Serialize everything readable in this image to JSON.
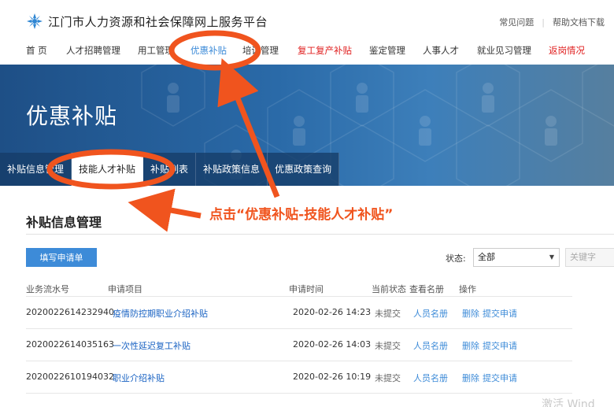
{
  "header": {
    "site_title": "江门市人力资源和社会保障网上服务平台",
    "links": [
      "常见问题",
      "帮助文档下载"
    ]
  },
  "nav": {
    "items": [
      {
        "label": "首 页"
      },
      {
        "label": "人才招聘管理"
      },
      {
        "label": "用工管理"
      },
      {
        "label": "优惠补贴"
      },
      {
        "label": "培训管理"
      },
      {
        "label": "复工复产补贴"
      },
      {
        "label": "鉴定管理"
      },
      {
        "label": "人事人才"
      },
      {
        "label": "就业见习管理"
      },
      {
        "label": "返岗情况"
      }
    ]
  },
  "banner": {
    "title": "优惠补贴"
  },
  "tabs": [
    "补贴信息管理",
    "技能人才补贴",
    "补贴列表",
    "补贴政策信息",
    "优惠政策查询"
  ],
  "main": {
    "section_title": "补贴信息管理",
    "apply_button": "填写申请单",
    "status_label": "状态:",
    "status_value": "全部",
    "keyword_placeholder": "关键字"
  },
  "table": {
    "headers": [
      "业务流水号",
      "申请项目",
      "申请时间",
      "当前状态",
      "查看名册",
      "操作"
    ],
    "rows": [
      {
        "id": "2020022614232940",
        "item": "疫情防控期职业介绍补贴",
        "time": "2020-02-26 14:23",
        "status": "未提交",
        "roster": "人员名册",
        "delete": "删除",
        "submit": "提交申请"
      },
      {
        "id": "2020022614035163",
        "item": "一次性延迟复工补贴",
        "time": "2020-02-26 14:03",
        "status": "未提交",
        "roster": "人员名册",
        "delete": "删除",
        "submit": "提交申请"
      },
      {
        "id": "2020022610194032",
        "item": "职业介绍补贴",
        "time": "2020-02-26 10:19",
        "status": "未提交",
        "roster": "人员名册",
        "delete": "删除",
        "submit": "提交申请"
      }
    ]
  },
  "annotation": {
    "text": "点击“优惠补贴-技能人才补贴”",
    "color": "#f0541e"
  },
  "watermark": "激活 Wind",
  "colors": {
    "accent": "#3d8bd8",
    "nav_red": "#e02020",
    "banner": "#2a6aa8"
  },
  "icons": {
    "logo": "snowflake-logo-icon",
    "select_arrow": "caret-down-icon"
  }
}
